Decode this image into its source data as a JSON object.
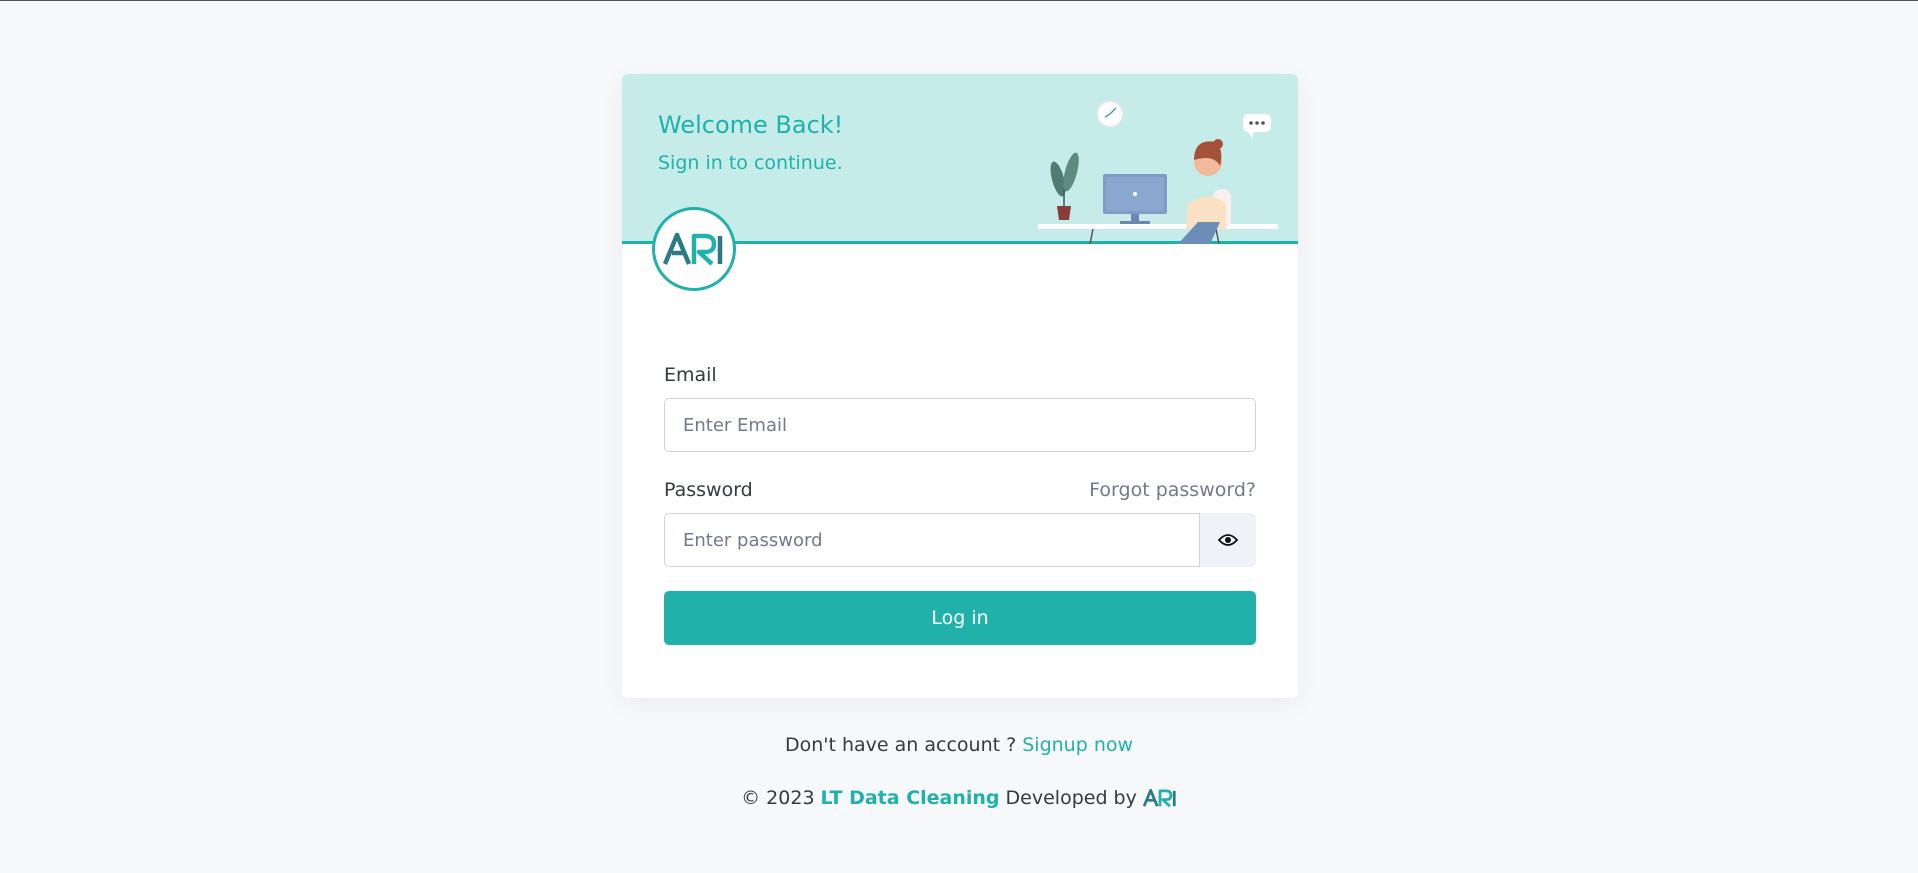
{
  "header": {
    "title": "Welcome Back!",
    "subtitle": "Sign in to continue.",
    "logo_text": "ARI"
  },
  "form": {
    "email_label": "Email",
    "email_placeholder": "Enter Email",
    "password_label": "Password",
    "forgot_label": "Forgot password?",
    "password_placeholder": "Enter password",
    "login_label": "Log in"
  },
  "footer": {
    "signup_prompt": "Don't have an account ?",
    "signup_link": "Signup now",
    "copyright_prefix": "© 2023",
    "brand": "LT Data Cleaning",
    "developed_by": "Developed by",
    "developer_logo": "ARI"
  },
  "colors": {
    "accent": "#1fb1aa",
    "header_bg": "#c6ece9",
    "page_bg": "#f7f8fa"
  },
  "icons": [
    "ari-logo-icon",
    "eye-icon",
    "office-illustration"
  ]
}
